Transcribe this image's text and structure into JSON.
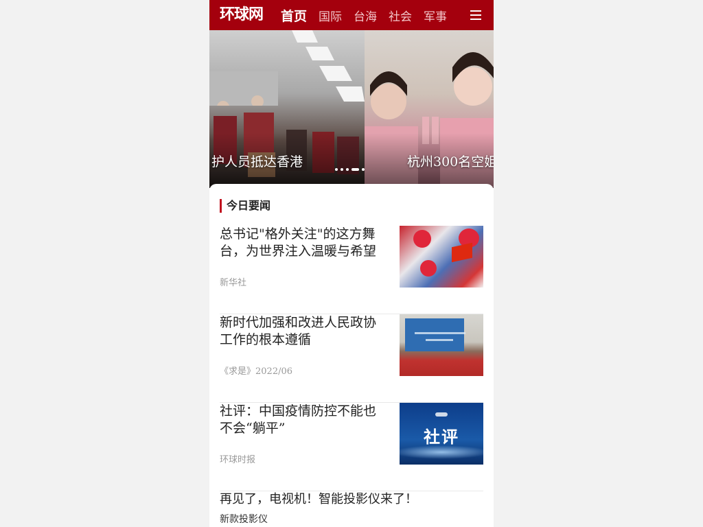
{
  "header": {
    "logo": "环球网",
    "nav": [
      "首页",
      "国际",
      "台海",
      "社会",
      "军事"
    ],
    "menu_icon": "hamburger-menu-icon",
    "brand_color": "#a4000d"
  },
  "carousel": {
    "slides": [
      {
        "caption": "护人员抵达香港"
      },
      {
        "caption": "杭州300名空姐"
      }
    ],
    "dot_count": 5,
    "active_dot": 3
  },
  "section": {
    "title": "今日要闻",
    "accent": "#c1121f"
  },
  "news": [
    {
      "title": "总书记\"格外关注\"的这方舞台，为世界注入温暖与希望",
      "source": "新华社"
    },
    {
      "title": "新时代加强和改进人民政协工作的根本遵循",
      "source": "《求是》2022/06"
    },
    {
      "title": "社评：中国疫情防控不能也不会“躺平”",
      "source": "环球时报",
      "thumb_text": "社评"
    }
  ],
  "ad": {
    "title": "再见了，电视机！智能投影仪来了！",
    "source": "新款投影仪"
  }
}
